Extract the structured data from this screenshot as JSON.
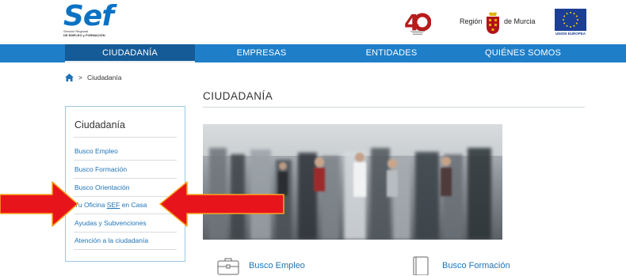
{
  "header": {
    "logo_word": "Sef",
    "logo_sub_line1": "Servicio Regional",
    "logo_sub_line2": "DE EMPLEO y FORMACIÓN",
    "region_text_a": "Región",
    "region_text_b": "de Murcia",
    "eu_label": "UNION EUROPEA"
  },
  "nav": {
    "items": [
      {
        "label": "CIUDADANÍA",
        "active": true
      },
      {
        "label": "EMPRESAS",
        "active": false
      },
      {
        "label": "ENTIDADES",
        "active": false
      },
      {
        "label": "QUIÉNES SOMOS",
        "active": false
      }
    ]
  },
  "breadcrumb": {
    "separator": ">",
    "current": "Ciudadanía"
  },
  "main": {
    "title": "CIUDADANÍA"
  },
  "sidebar": {
    "title": "Ciudadanía",
    "items": [
      {
        "label": "Busco Empleo"
      },
      {
        "label": "Busco Formación"
      },
      {
        "label": "Busco Orientación"
      },
      {
        "label_pre": "Tu Oficina ",
        "label_underlined": "SEF",
        "label_post": " en Casa"
      },
      {
        "label": "Ayudas y Subvenciones"
      },
      {
        "label": "Atención a la ciudadanía"
      }
    ]
  },
  "cards": [
    {
      "label": "Busco Empleo",
      "icon": "briefcase-icon"
    },
    {
      "label": "Busco Formación",
      "icon": "book-icon"
    }
  ],
  "colors": {
    "brand_blue": "#1e7ec8",
    "nav_active": "#155b97",
    "link_blue": "#1f73b7",
    "arrow_red": "#e8141b",
    "arrow_stroke": "#f5a623"
  }
}
